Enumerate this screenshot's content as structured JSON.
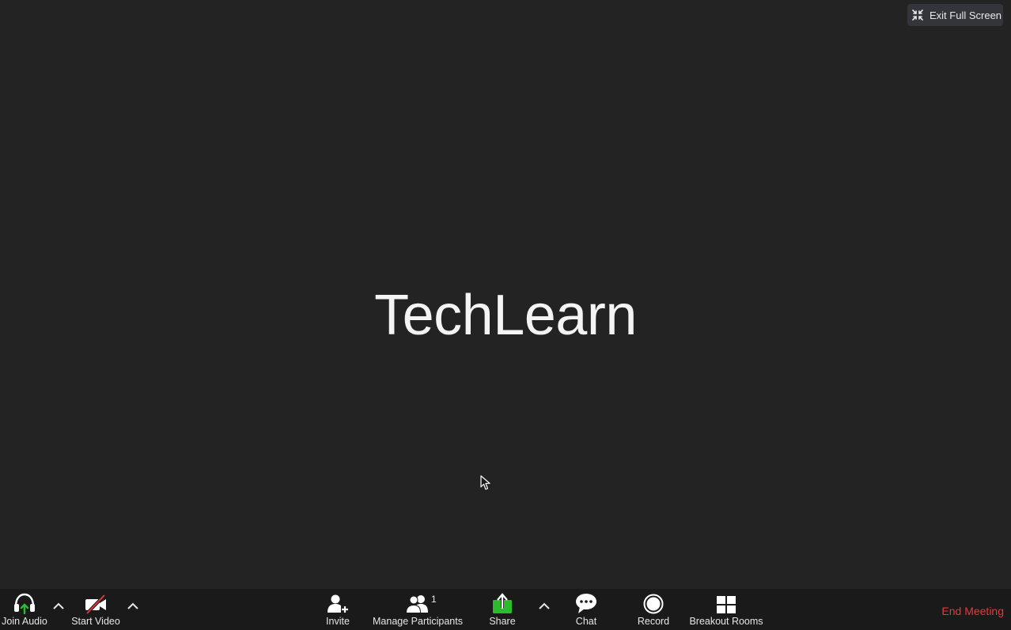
{
  "exit_fullscreen": {
    "label": "Exit Full Screen",
    "icon": "exit-fullscreen-icon"
  },
  "stage": {
    "host_name": "TechLearn"
  },
  "toolbar": {
    "join_audio": {
      "label": "Join Audio",
      "icon": "headphones-icon"
    },
    "start_video": {
      "label": "Start Video",
      "icon": "video-off-icon"
    },
    "invite": {
      "label": "Invite",
      "icon": "add-user-icon"
    },
    "manage_participants": {
      "label": "Manage Participants",
      "count": "1",
      "icon": "participants-icon"
    },
    "share": {
      "label": "Share",
      "icon": "share-screen-icon"
    },
    "chat": {
      "label": "Chat",
      "icon": "chat-bubble-icon"
    },
    "record": {
      "label": "Record",
      "icon": "record-icon"
    },
    "breakout_rooms": {
      "label": "Breakout Rooms",
      "icon": "grid-icon"
    },
    "end_meeting": {
      "label": "End Meeting"
    }
  },
  "colors": {
    "background": "#232323",
    "toolbar": "#1a1a1a",
    "share_green": "#2dbb2d",
    "end_red": "#e8373b",
    "audio_arrow_green": "#2dbb2d",
    "video_slash_red": "#e8373b"
  }
}
